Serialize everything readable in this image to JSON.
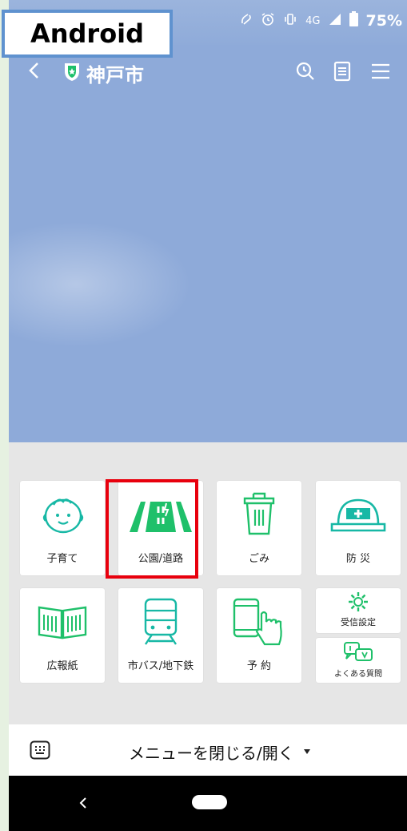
{
  "os_label": "Android",
  "status_bar": {
    "network": "4G",
    "battery": "75%",
    "icons": [
      "nfc-icon",
      "alarm-icon",
      "vibrate-icon",
      "signal-icon",
      "battery-icon"
    ]
  },
  "header": {
    "title": "神戸市",
    "icons": [
      "back-icon",
      "shield-icon",
      "search-history-icon",
      "notes-icon",
      "menu-icon"
    ]
  },
  "menu": {
    "tiles": [
      {
        "label": "子育て",
        "icon": "baby-face-icon"
      },
      {
        "label": "公園/道路",
        "icon": "road-icon",
        "highlighted": true
      },
      {
        "label": "ごみ",
        "icon": "trash-can-icon"
      },
      {
        "label": "防 災",
        "icon": "helmet-icon"
      },
      {
        "label": "広報紙",
        "icon": "newspaper-icon"
      },
      {
        "label": "市バス/地下鉄",
        "icon": "train-icon"
      },
      {
        "label": "予 約",
        "icon": "phone-tap-icon"
      },
      {
        "label": "受信設定",
        "icon": "gear-icon"
      },
      {
        "label": "よくある質問",
        "icon": "qa-bubble-icon"
      }
    ]
  },
  "footer": {
    "label": "メニューを閉じる/開く",
    "icons": [
      "keyboard-icon",
      "caret-down-icon"
    ]
  },
  "navbar": {
    "icons": [
      "nav-back-icon",
      "home-pill-icon"
    ]
  },
  "colors": {
    "accent_green": "#1fc06a",
    "header_bg": "#8eaad9",
    "highlight_red": "#e8000d",
    "badge_border": "#5f92cf"
  }
}
